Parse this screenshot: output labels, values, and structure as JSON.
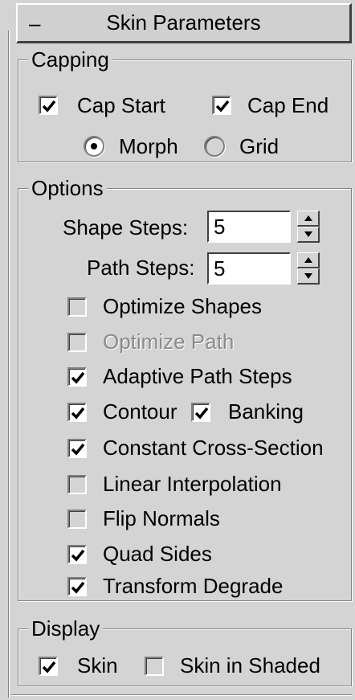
{
  "rollout": {
    "title": "Skin Parameters",
    "collapse_symbol": "–"
  },
  "capping": {
    "label": "Capping",
    "cap_start": {
      "label": "Cap Start",
      "checked": true
    },
    "cap_end": {
      "label": "Cap End",
      "checked": true
    },
    "morph": {
      "label": "Morph",
      "selected": true
    },
    "grid": {
      "label": "Grid",
      "selected": false
    }
  },
  "options": {
    "label": "Options",
    "shape_steps": {
      "label": "Shape Steps:",
      "value": "5"
    },
    "path_steps": {
      "label": "Path Steps:",
      "value": "5"
    },
    "optimize_shapes": {
      "label": "Optimize Shapes",
      "checked": false
    },
    "optimize_path": {
      "label": "Optimize Path",
      "checked": false,
      "disabled": true
    },
    "adaptive_path_steps": {
      "label": "Adaptive Path Steps",
      "checked": true
    },
    "contour": {
      "label": "Contour",
      "checked": true
    },
    "banking": {
      "label": "Banking",
      "checked": true
    },
    "constant_cross_section": {
      "label": "Constant Cross-Section",
      "checked": true
    },
    "linear_interpolation": {
      "label": "Linear Interpolation",
      "checked": false
    },
    "flip_normals": {
      "label": "Flip Normals",
      "checked": false
    },
    "quad_sides": {
      "label": "Quad Sides",
      "checked": true
    },
    "transform_degrade": {
      "label": "Transform Degrade",
      "checked": true
    }
  },
  "display": {
    "label": "Display",
    "skin": {
      "label": "Skin",
      "checked": true
    },
    "skin_in_shaded": {
      "label": "Skin in Shaded",
      "checked": false
    }
  }
}
